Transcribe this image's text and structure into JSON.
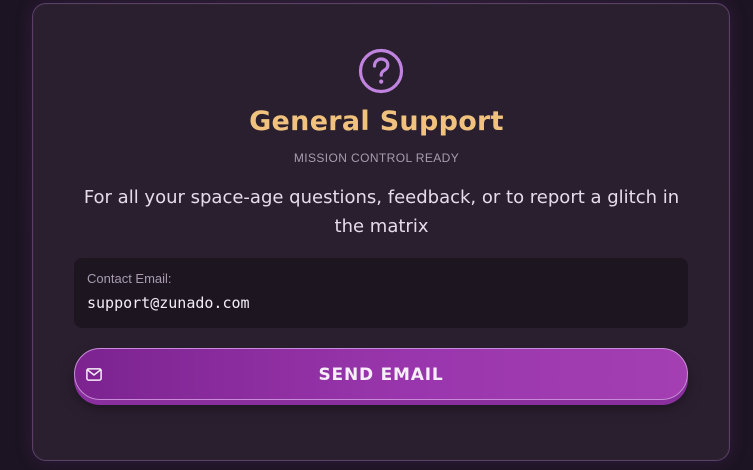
{
  "card": {
    "icon": "question-circle-icon",
    "title": "General Support",
    "subtitle": "MISSION CONTROL READY",
    "description": "For all your space-age questions, feedback, or to report a glitch in the matrix"
  },
  "contact": {
    "label": "Contact Email:",
    "email": "support@zunado.com"
  },
  "button": {
    "label": "SEND EMAIL",
    "icon": "mail-icon"
  },
  "colors": {
    "accent_title": "#f0c27e",
    "accent_purple": "#c084e0",
    "button_gradient_start": "#7c2390",
    "button_gradient_end": "#a43fb2"
  }
}
